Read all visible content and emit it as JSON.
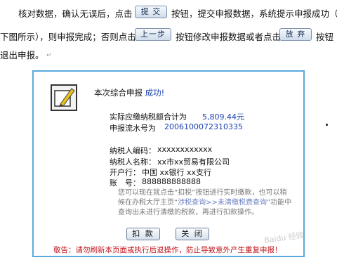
{
  "instructions": {
    "line1_a": "核对数据，确认无误后，点击",
    "line1_b": "按钮，提交申报数据，系统提示申报成功（如",
    "line2_a": "下图所示），则申报完成；否则点击",
    "line2_b": "按钮修改申报数据或者点击",
    "line2_c": "按钮",
    "line3": "退出申报。",
    "submit_label": "提 交",
    "prev_label": "上一步",
    "abandon_label": "放 弃",
    "paragraph_mark": "↵"
  },
  "dialog": {
    "title_prefix": "本次综合申报",
    "title_status": "成功!",
    "tax_label": "实际应缴纳税额合计为",
    "tax_value": "5,809.44元",
    "serial_label": "申报流水号为",
    "serial_value": "2006100072310335",
    "taxpayer_id_label": "纳税人编码：",
    "taxpayer_id_value": "xxxxxxxxxxxx",
    "taxpayer_name_label": "纳税人名称：",
    "taxpayer_name_value": "xx市xx贸易有限公司",
    "bank_label": "开户行：",
    "bank_value": "中国 xx银行 xx支行",
    "account_label": "账　号：",
    "account_value": "888888888888",
    "note_a": "您可以现在就点击“扣税”按钮进行实时缴款，也可以稍候在办税大厅主页“",
    "note_link": "涉税查询>>未清缴税费查询",
    "note_b": "”功能中查询出未进行清缴的税款，再进行扣款操作。",
    "deduct_label": "扣 款",
    "close_label": "关 闭",
    "warning": "敬告：请勿刷新本页面或执行后退操作，防止导致意外产生重复申报！"
  },
  "watermark": "Baidu 经验"
}
